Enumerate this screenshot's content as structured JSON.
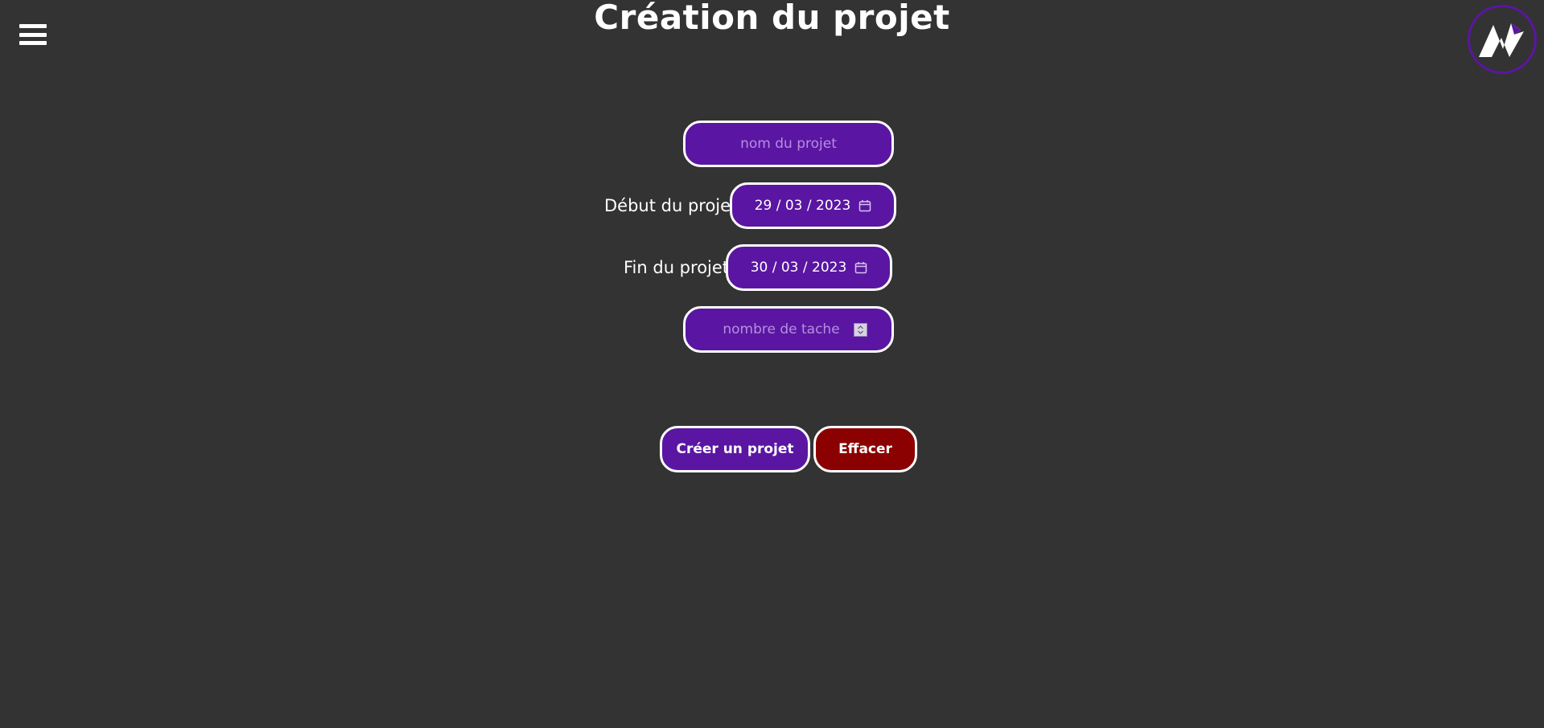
{
  "header": {
    "title": "Création du projet",
    "menu_icon": "hamburger-menu-icon",
    "logo_icon": "app-logo-icon"
  },
  "form": {
    "project_name": {
      "placeholder": "nom du projet",
      "value": ""
    },
    "start_date": {
      "label": "Début du projet",
      "value": "29 / 03 / 2023",
      "icon": "calendar-icon"
    },
    "end_date": {
      "label": "Fin du projet",
      "value": "30 / 03 / 2023",
      "icon": "calendar-icon"
    },
    "task_count": {
      "placeholder": "nombre de tache",
      "value": "",
      "icon": "spinner-icon"
    }
  },
  "actions": {
    "create_label": "Créer un projet",
    "clear_label": "Effacer"
  },
  "colors": {
    "background": "#333333",
    "field_purple": "#5a16a2",
    "clear_red": "#8b0000",
    "border_white": "#ffffff",
    "placeholder": "#b68ee0"
  }
}
